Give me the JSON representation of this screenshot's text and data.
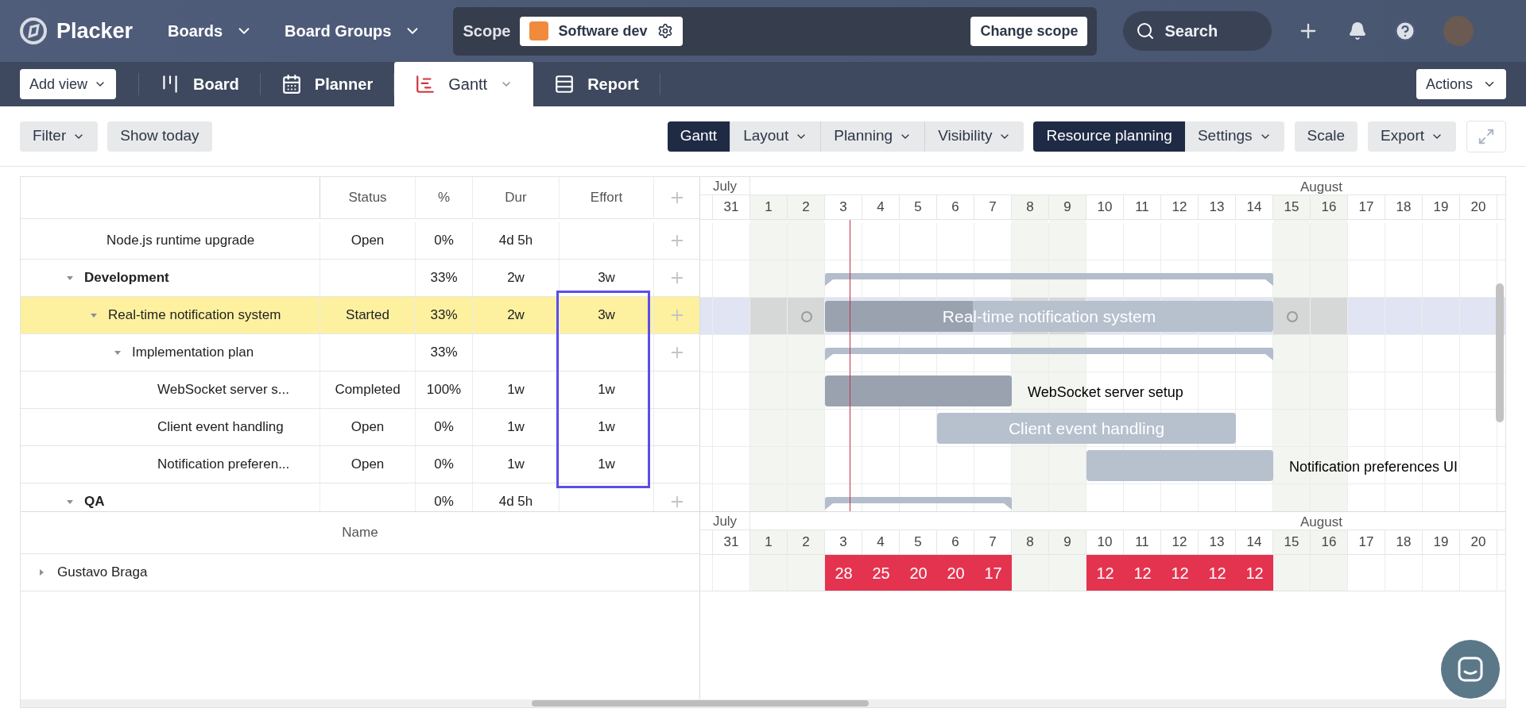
{
  "app": {
    "name": "Placker",
    "nav": [
      {
        "label": "Boards"
      },
      {
        "label": "Board Groups"
      }
    ],
    "scope": {
      "label": "Scope",
      "value": "Software dev",
      "button": "Change scope"
    },
    "search": {
      "placeholder": "Search"
    }
  },
  "views": {
    "add_view": "Add view",
    "tabs": [
      {
        "label": "Board",
        "kind": "board",
        "selected": false
      },
      {
        "label": "Planner",
        "kind": "planner",
        "selected": false
      },
      {
        "label": "Gantt",
        "kind": "gantt",
        "selected": true
      },
      {
        "label": "Report",
        "kind": "report",
        "selected": false
      }
    ],
    "actions": "Actions"
  },
  "toolbar": {
    "left": [
      {
        "label": "Filter",
        "menu": true
      },
      {
        "label": "Show today",
        "menu": false
      }
    ],
    "modes": [
      {
        "label": "Gantt",
        "menu": false,
        "selected": true
      },
      {
        "label": "Layout",
        "menu": true,
        "selected": false
      },
      {
        "label": "Planning",
        "menu": true,
        "selected": false
      },
      {
        "label": "Visibility",
        "menu": true,
        "selected": false
      }
    ],
    "resource": [
      {
        "label": "Resource planning",
        "menu": false,
        "selected": true
      },
      {
        "label": "Settings",
        "menu": true,
        "selected": false
      }
    ],
    "right": [
      {
        "label": "Scale",
        "menu": false
      },
      {
        "label": "Export",
        "menu": true
      }
    ]
  },
  "table": {
    "columns": [
      "Status",
      "%",
      "Dur",
      "Effort"
    ],
    "tasks": [
      {
        "kind": "task",
        "name": "Node.js runtime upgrade",
        "status": "Open",
        "percent": "0%",
        "dur": "4d 5h",
        "addable": true,
        "selected": false
      },
      {
        "kind": "group",
        "name": "Development",
        "percent": "33%",
        "dur": "2w",
        "effort": "3w",
        "addable": true,
        "selected": false,
        "expanded": true,
        "bar": {
          "kind": "summary"
        },
        "children": [
          {
            "kind": "task",
            "name": "Real-time notification system",
            "status": "Started",
            "percent": "33%",
            "dur": "2w",
            "effort": "3w",
            "addable": true,
            "selected": true,
            "expanded": true,
            "bar": {
              "kind": "task",
              "level": 0.33,
              "label": "Real-time notification system",
              "label_inside": true
            },
            "children": [
              {
                "kind": "task",
                "name": "Implementation plan",
                "percent": "33%",
                "addable": true,
                "selected": false,
                "expanded": true,
                "bar": {
                  "kind": "summary"
                },
                "children": [
                  {
                    "kind": "task",
                    "name": "WebSocket server s...",
                    "status": "Completed",
                    "percent": "100%",
                    "dur": "1w",
                    "effort": "1w",
                    "addable": false,
                    "selected": false,
                    "bar": {
                      "kind": "task",
                      "level": 1,
                      "label": "WebSocket server setup",
                      "label_inside": false
                    }
                  },
                  {
                    "kind": "task",
                    "name": "Client event handling",
                    "status": "Open",
                    "percent": "0%",
                    "dur": "1w",
                    "effort": "1w",
                    "addable": false,
                    "selected": false,
                    "bar": {
                      "kind": "task",
                      "level": 0,
                      "label": "Client event handling",
                      "label_inside": true
                    }
                  },
                  {
                    "kind": "task",
                    "name": "Notification preferen...",
                    "status": "Open",
                    "percent": "0%",
                    "dur": "1w",
                    "effort": "1w",
                    "addable": false,
                    "selected": false,
                    "bar": {
                      "kind": "task",
                      "level": 0,
                      "label": "Notification preferences UI",
                      "label_inside": false
                    }
                  }
                ]
              }
            ]
          }
        ]
      },
      {
        "kind": "group",
        "name": "QA",
        "percent": "0%",
        "dur": "4d 5h",
        "addable": true,
        "selected": false,
        "expanded": true,
        "bar": {
          "kind": "summary"
        }
      }
    ]
  },
  "timeline": {
    "months": [
      "July",
      "August"
    ],
    "days": [
      {
        "label": "31",
        "weekend": false
      },
      {
        "label": "1",
        "weekend": true
      },
      {
        "label": "2",
        "weekend": true
      },
      {
        "label": "3",
        "weekend": false
      },
      {
        "label": "4",
        "weekend": false
      },
      {
        "label": "5",
        "weekend": false
      },
      {
        "label": "6",
        "weekend": false
      },
      {
        "label": "7",
        "weekend": false
      },
      {
        "label": "8",
        "weekend": true
      },
      {
        "label": "9",
        "weekend": true
      },
      {
        "label": "10",
        "weekend": false
      },
      {
        "label": "11",
        "weekend": false
      },
      {
        "label": "12",
        "weekend": false
      },
      {
        "label": "13",
        "weekend": false
      },
      {
        "label": "14",
        "weekend": false
      },
      {
        "label": "15",
        "weekend": true
      },
      {
        "label": "16",
        "weekend": true
      },
      {
        "label": "17",
        "weekend": false
      },
      {
        "label": "18",
        "weekend": false
      },
      {
        "label": "19",
        "weekend": false
      },
      {
        "label": "20",
        "weekend": false
      }
    ]
  },
  "resources": {
    "column": "Name",
    "timeline": {
      "months": [
        "July",
        "August"
      ],
      "days": [
        {
          "label": "31",
          "weekend": false
        },
        {
          "label": "1",
          "weekend": true
        },
        {
          "label": "2",
          "weekend": true
        },
        {
          "label": "3",
          "weekend": false
        },
        {
          "label": "4",
          "weekend": false
        },
        {
          "label": "5",
          "weekend": false
        },
        {
          "label": "6",
          "weekend": false
        },
        {
          "label": "7",
          "weekend": false
        },
        {
          "label": "8",
          "weekend": true
        },
        {
          "label": "9",
          "weekend": true
        },
        {
          "label": "10",
          "weekend": false
        },
        {
          "label": "11",
          "weekend": false
        },
        {
          "label": "12",
          "weekend": false
        },
        {
          "label": "13",
          "weekend": false
        },
        {
          "label": "14",
          "weekend": false
        },
        {
          "label": "15",
          "weekend": true
        },
        {
          "label": "16",
          "weekend": true
        },
        {
          "label": "17",
          "weekend": false
        },
        {
          "label": "18",
          "weekend": false
        },
        {
          "label": "19",
          "weekend": false
        },
        {
          "label": "20",
          "weekend": false
        }
      ]
    },
    "people": [
      {
        "name": "Gustavo Braga",
        "expanded": false,
        "loads": [
          "28",
          "25",
          "20",
          "20",
          "17",
          "12",
          "12",
          "12",
          "12",
          "12"
        ]
      }
    ]
  }
}
